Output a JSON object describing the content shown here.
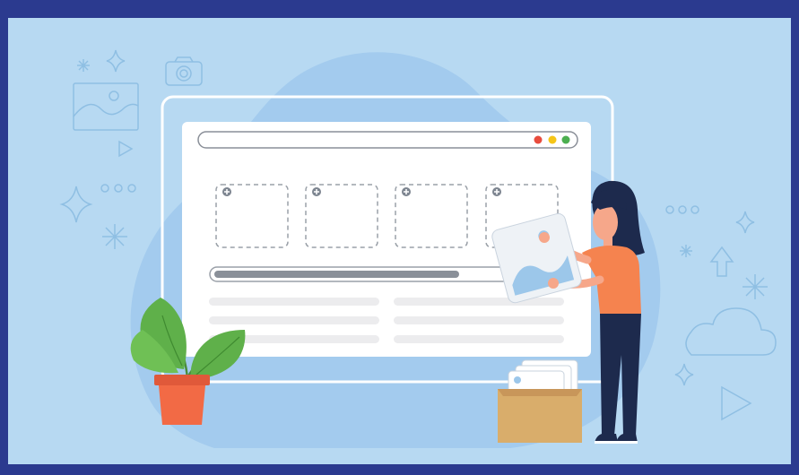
{
  "illustration": {
    "background_color": "#b7d9f2",
    "border_color": "#2b3a8f",
    "blob_color": "#a3cbee",
    "line_icon_color": "#8fbfe3",
    "browser": {
      "window_dots": [
        "#e84c3d",
        "#f5c518",
        "#4caf50"
      ],
      "upload_slot_count": 4,
      "progress_fraction": 0.7
    },
    "person": {
      "shirt_color": "#f5834f",
      "pants_color": "#1d2a4d",
      "hair_color": "#1d2a4d"
    },
    "plant": {
      "pot_color": "#f26a45",
      "leaf_color": "#5fb04a"
    },
    "box_color": "#d9ad6b",
    "icons": [
      "sparkle-icon",
      "star-icon",
      "camera-icon",
      "image-icon",
      "play-icon",
      "ellipsis-icon",
      "cloud-icon",
      "arrow-up-icon"
    ]
  }
}
